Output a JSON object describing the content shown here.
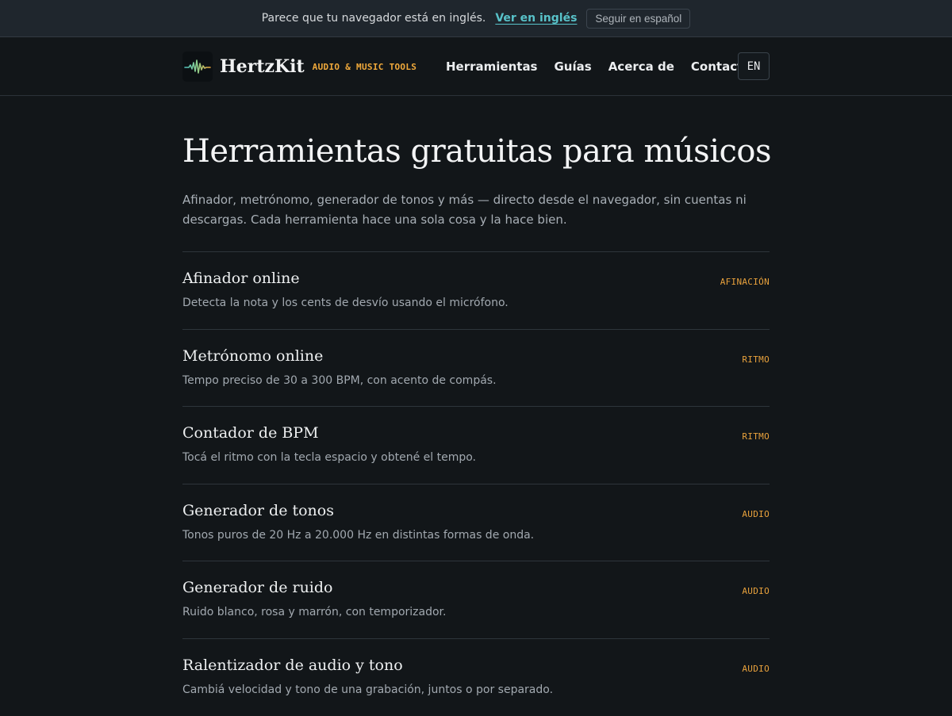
{
  "banner": {
    "message": "Parece que tu navegador está en inglés.",
    "switch_label": "Ver en inglés",
    "stay_label": "Seguir en español"
  },
  "header": {
    "brand_name": "HertzKit",
    "brand_tagline": "AUDIO & MUSIC TOOLS",
    "logo_icon": "waveform-icon",
    "nav": [
      "Herramientas",
      "Guías",
      "Acerca de",
      "Contacto"
    ],
    "language_button": "EN"
  },
  "main": {
    "title": "Herramientas gratuitas para músicos",
    "intro": "Afinador, metrónomo, generador de tonos y más — directo desde el navegador, sin cuentas ni descargas. Cada herramienta hace una sola cosa y la hace bien.",
    "tools": [
      {
        "name": "Afinador online",
        "description": "Detecta la nota y los cents de desvío usando el micrófono.",
        "category": "AFINACIÓN"
      },
      {
        "name": "Metrónomo online",
        "description": "Tempo preciso de 30 a 300 BPM, con acento de compás.",
        "category": "RITMO"
      },
      {
        "name": "Contador de BPM",
        "description": "Tocá el ritmo con la tecla espacio y obtené el tempo.",
        "category": "RITMO"
      },
      {
        "name": "Generador de tonos",
        "description": "Tonos puros de 20 Hz a 20.000 Hz en distintas formas de onda.",
        "category": "AUDIO"
      },
      {
        "name": "Generador de ruido",
        "description": "Ruido blanco, rosa y marrón, con temporizador.",
        "category": "AUDIO"
      },
      {
        "name": "Ralentizador de audio y tono",
        "description": "Cambiá velocidad y tono de una grabación, juntos o por separado.",
        "category": "AUDIO"
      }
    ]
  },
  "colors": {
    "background": "#121619",
    "accent_teal": "#58c2c9",
    "accent_orange": "#f0a93b"
  }
}
